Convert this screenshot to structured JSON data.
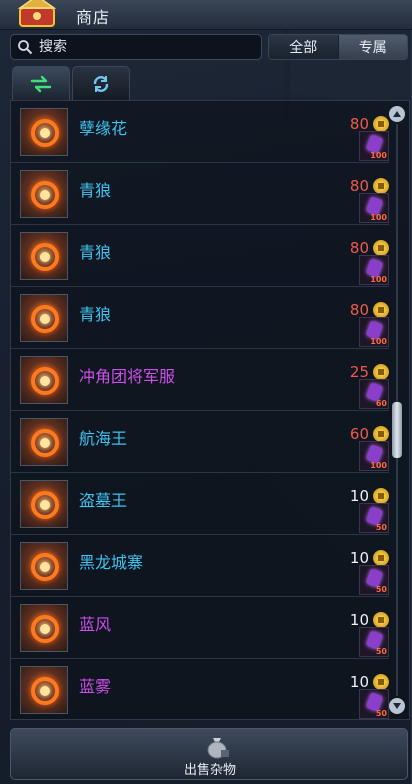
{
  "window": {
    "title": "商店"
  },
  "search": {
    "placeholder": "搜索"
  },
  "filters": [
    {
      "label": "全部",
      "active": false
    },
    {
      "label": "专属",
      "active": true
    }
  ],
  "tabs": [
    {
      "icon": "swap-arrows-icon",
      "active": true
    },
    {
      "icon": "refresh-icon",
      "active": false
    }
  ],
  "items": [
    {
      "name": "孽缘花",
      "name_color": "blue",
      "price": "80",
      "price_color": "red",
      "badge_qty": "100"
    },
    {
      "name": "青狼",
      "name_color": "blue",
      "price": "80",
      "price_color": "red",
      "badge_qty": "100"
    },
    {
      "name": "青狼",
      "name_color": "blue",
      "price": "80",
      "price_color": "red",
      "badge_qty": "100"
    },
    {
      "name": "青狼",
      "name_color": "blue",
      "price": "80",
      "price_color": "red",
      "badge_qty": "100"
    },
    {
      "name": "冲角团将军服",
      "name_color": "purple",
      "price": "25",
      "price_color": "red",
      "badge_qty": "60"
    },
    {
      "name": "航海王",
      "name_color": "blue",
      "price": "60",
      "price_color": "red",
      "badge_qty": "100"
    },
    {
      "name": "盗墓王",
      "name_color": "blue",
      "price": "10",
      "price_color": "white",
      "badge_qty": "50"
    },
    {
      "name": "黑龙城寨",
      "name_color": "blue",
      "price": "10",
      "price_color": "white",
      "badge_qty": "50"
    },
    {
      "name": "蓝风",
      "name_color": "purple",
      "price": "10",
      "price_color": "white",
      "badge_qty": "50"
    },
    {
      "name": "蓝雾",
      "name_color": "purple",
      "price": "10",
      "price_color": "white",
      "badge_qty": "50"
    }
  ],
  "footer": {
    "sell_label": "出售杂物"
  },
  "colors": {
    "name_blue": "#3fc3f0",
    "name_purple": "#cc4fe8",
    "price_red": "#f05a4a",
    "coin_gold": "#f2c230"
  }
}
